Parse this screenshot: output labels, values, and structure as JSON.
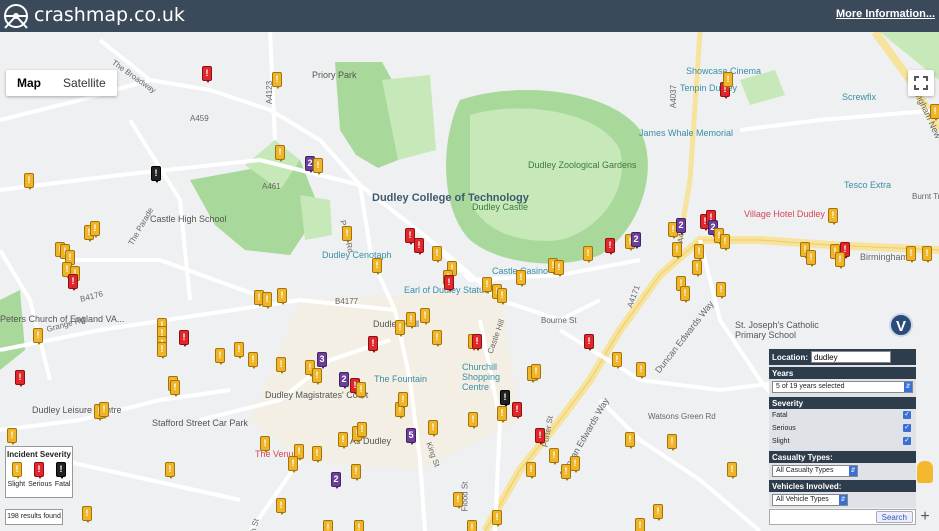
{
  "header": {
    "site_name": "crashmap.co.uk",
    "more_info": "More Information..."
  },
  "map_controls": {
    "map_tab": "Map",
    "satellite_tab": "Satellite",
    "active_tab": "Map"
  },
  "map_labels": {
    "priory_park": "Priory Park",
    "showcase_cinema": "Showcase Cinema",
    "tenpin_dudley": "Tenpin Dudley",
    "screwfix": "Screwfix",
    "james_whale": "James Whale Memorial",
    "zoo": "Dudley Zoological Gardens",
    "tesco": "Tesco Extra",
    "castle_high": "Castle High School",
    "dudley_college": "Dudley College of Technology",
    "dudley_castle": "Dudley Castle",
    "village_hotel": "Village Hotel Dudley",
    "cenotaph": "Dudley Cenotaph",
    "casino": "Castle Casino",
    "earl_statue": "Earl of Dudley Statue",
    "st_josephs": "St. Joseph's Catholic Primary School",
    "church": "Peters Church of England VA...",
    "dudley_hall": "Dudley Hall",
    "fountain": "The Fountain",
    "churchill": "Churchill Shopping Centre",
    "magistrates": "Dudley Magistrates' Court",
    "leisure": "Dudley Leisure Centre",
    "stafford_car_park": "Stafford Street Car Park",
    "as_dudley": "As Dudley",
    "the_venue": "The Venue",
    "duncan_edwards_way": "Duncan Edwards Way",
    "duncan_edwards_way_2": "Duncan Edwards Way",
    "birmingham_new": "Birmingham New",
    "birmingham": "Birmingham",
    "burnt_tree": "Burnt Tr",
    "broadway": "The Broadway",
    "a459": "A459",
    "a4037": "A4037",
    "a4171": "A4171",
    "a4123": "A4123",
    "b4176": "B4176",
    "b4177": "B4177",
    "a4101": "A4101",
    "a461": "A461",
    "priory_rd": "Priory Rd",
    "bourne_st": "Bourne St",
    "flood_st": "Flood St",
    "high_st": "High St",
    "king_st": "King St",
    "porter_st": "Porter St",
    "watsons_green": "Watsons Green Rd",
    "castle_hill": "Castle Hill",
    "grange_rd": "Grange Rd",
    "the_parade": "The Parade"
  },
  "legend": {
    "title": "Incident Severity",
    "slight": "Slight",
    "serious": "Serious",
    "fatal": "Fatal",
    "results": "198 results found"
  },
  "panel": {
    "location_label": "Location:",
    "location_value": "dudley",
    "years_label": "Years",
    "years_value": "5 of 19 years selected",
    "severity_label": "Severity",
    "severity_options": [
      "Fatal",
      "Serious",
      "Slight"
    ],
    "casualty_label": "Casualty Types:",
    "casualty_value": "All Casualty Types",
    "vehicles_label": "Vehicles Involved:",
    "vehicles_value": "All Vehicle Types",
    "search_button": "Search",
    "logo_letter": "V"
  },
  "marker_colors": {
    "slight": "#f0b429",
    "serious": "#e0272b",
    "fatal": "#222222",
    "cluster": "#6b3f9b"
  },
  "cluster_counts": [
    "2",
    "2",
    "2",
    "2",
    "3",
    "2",
    "5",
    "2"
  ]
}
